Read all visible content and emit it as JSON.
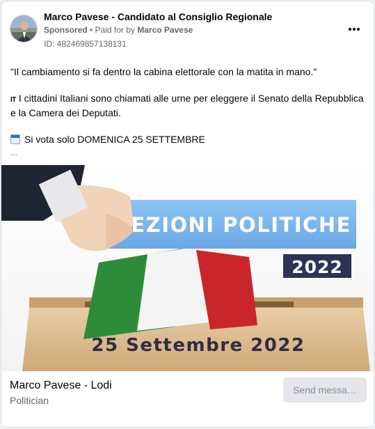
{
  "header": {
    "page_name": "Marco Pavese - Candidato al Consiglio Regionale",
    "sponsored_label": "Sponsored",
    "separator": " • ",
    "paid_for_prefix": "Paid for by ",
    "paid_for_name": "Marco Pavese",
    "ad_id": "ID: 482469857138131",
    "more_icon": "more-horizontal-icon"
  },
  "post": {
    "quote": "\"Il cambiamento si fa dentro la cabina elettorale con la matita in mano.\"",
    "flag_icon_label": "IT",
    "paragraph": "I cittadini Italiani sono chiamati alle urne per eleggere il Senato della Repubblica e la Camera dei Deputati.",
    "calendar_icon": "calendar-icon",
    "vote_date_line": "Si vota solo DOMENICA 25 SETTEMBRE",
    "see_more": "..."
  },
  "image": {
    "headline": "ELEZIONI POLITICHE",
    "year": "2022",
    "date": "25 Settembre 2022",
    "colors": {
      "banner": "#7cb6ee",
      "banner_text": "#ffffff",
      "year_box": "#2e3158",
      "flag_green": "#2e8b3a",
      "flag_white": "#f4f4f4",
      "flag_red": "#c8262b",
      "box": "#dcbb8e",
      "date_text": "#2e2e45"
    }
  },
  "footer": {
    "title": "Marco Pavese - Lodi",
    "subtitle": "Politician",
    "send_button": "Send messa…"
  }
}
